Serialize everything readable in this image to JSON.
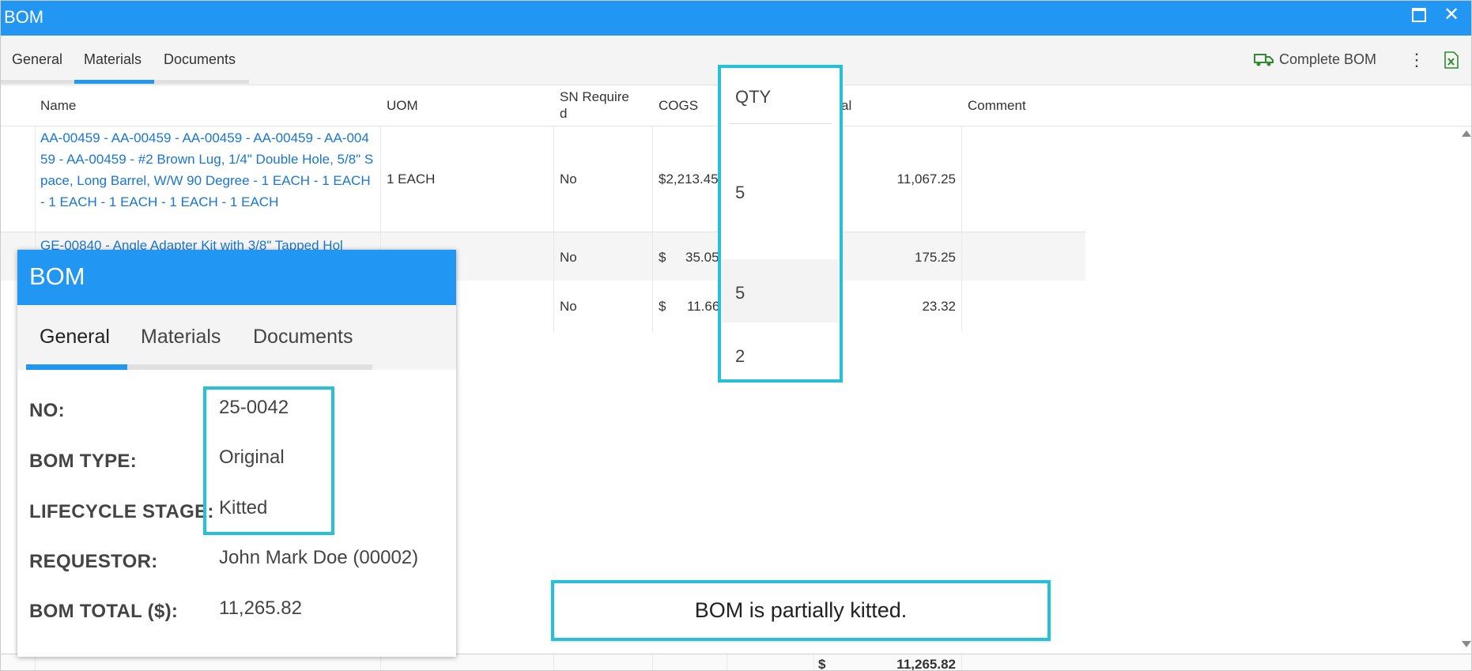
{
  "window": {
    "title": "BOM"
  },
  "tabs": [
    {
      "label": "General"
    },
    {
      "label": "Materials"
    },
    {
      "label": "Documents"
    }
  ],
  "toolbar": {
    "complete_label": "Complete BOM"
  },
  "grid": {
    "columns": {
      "name": "Name",
      "uom": "UOM",
      "sn": "SN Require\nd",
      "cogs": "COGS",
      "total": "al",
      "comment": "Comment"
    },
    "rows": [
      {
        "name": "AA-00459 - AA-00459 - AA-00459 - AA-00459 - AA-00459 - AA-00459 - #2 Brown Lug, 1/4\" Double Hole, 5/8\" Space, Long Barrel, W/W 90 Degree - 1 EACH - 1 EACH - 1 EACH - 1 EACH - 1 EACH - 1 EACH",
        "uom": "1 EACH",
        "sn": "No",
        "cogs": "$2,213.45",
        "total": "11,067.25"
      },
      {
        "name": "GE-00840 - Angle Adapter Kit with 3/8\" Tapped Hol",
        "uom": "",
        "sn": "No",
        "cogs_sym": "$",
        "cogs": "35.05",
        "total": "175.25"
      },
      {
        "name": "",
        "uom": "",
        "sn": "No",
        "cogs_sym": "$",
        "cogs": "11.66",
        "total": "23.32"
      }
    ],
    "footer": {
      "sym": "$",
      "total": "11,265.82"
    }
  },
  "qty_callout": {
    "header": "QTY",
    "values": [
      "5",
      "5",
      "2"
    ]
  },
  "bom_panel": {
    "title": "BOM",
    "tabs": [
      {
        "label": "General"
      },
      {
        "label": "Materials"
      },
      {
        "label": "Documents"
      }
    ],
    "fields": [
      {
        "label": "NO:",
        "value": "25-0042"
      },
      {
        "label": "BOM TYPE:",
        "value": "Original"
      },
      {
        "label": "LIFECYCLE STAGE:",
        "value": "Kitted"
      },
      {
        "label": "REQUESTOR:",
        "value": "John Mark Doe (00002)"
      },
      {
        "label": "BOM TOTAL ($):",
        "value": "11,265.82"
      }
    ]
  },
  "note": {
    "text": "BOM is partially kitted."
  },
  "colors": {
    "accent": "#2196f3",
    "callout": "#27c0d9",
    "link": "#1976d2",
    "excel": "#2e8b2e"
  }
}
